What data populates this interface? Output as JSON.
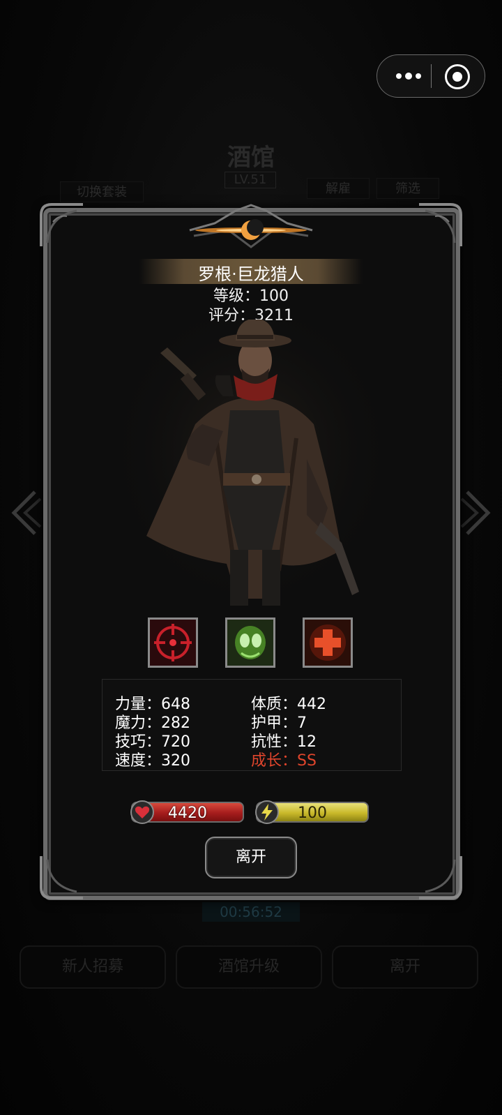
{
  "background": {
    "title": "酒馆",
    "level": "LV.51",
    "switch_outfit": "切换套装",
    "dismiss": "解雇",
    "filter": "筛选",
    "timer": "00:56:52",
    "bottom_buttons": [
      "新人招募",
      "酒馆升级",
      "离开"
    ]
  },
  "hero": {
    "name": "罗根·巨龙猎人",
    "level": "等级：100",
    "score": "评分：3211"
  },
  "skills": [
    {
      "icon": "crosshair-icon",
      "color": "#c8202a"
    },
    {
      "icon": "green-beast-icon",
      "color": "#6fcf3c"
    },
    {
      "icon": "red-cross-icon",
      "color": "#e8502a"
    }
  ],
  "stats": {
    "strength": "力量：648",
    "magic": "魔力：282",
    "skill": "技巧：720",
    "speed": "速度：320",
    "constitution": "体质：442",
    "armor": "护甲：7",
    "resistance": "抗性：12",
    "growth": "成长：SS"
  },
  "resources": {
    "hp": "4420",
    "energy": "100"
  },
  "leave_label": "离开",
  "colors": {
    "accent_red": "#e0452c",
    "hp_red": "#a51c1c",
    "energy_yellow": "#c9b92a"
  }
}
